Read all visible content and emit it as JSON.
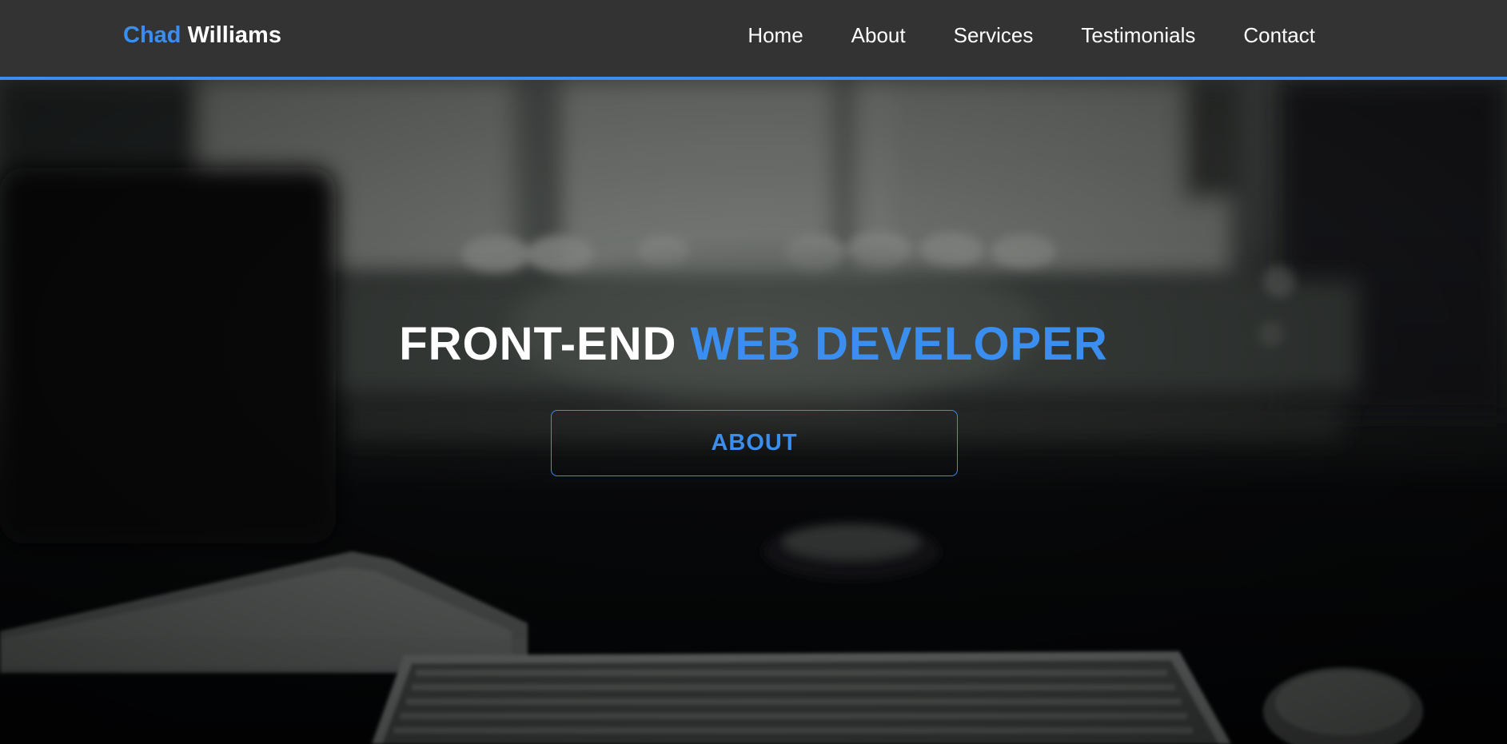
{
  "brand": {
    "first": "Chad",
    "last": "Williams"
  },
  "nav": [
    {
      "label": "Home"
    },
    {
      "label": "About"
    },
    {
      "label": "Services"
    },
    {
      "label": "Testimonials"
    },
    {
      "label": "Contact"
    }
  ],
  "hero": {
    "headline_white": "FRONT-END",
    "headline_blue": "WEB DEVELOPER",
    "button_label": "ABOUT"
  },
  "colors": {
    "accent": "#3a8ef0",
    "navbar": "#333333",
    "text": "#ffffff"
  }
}
